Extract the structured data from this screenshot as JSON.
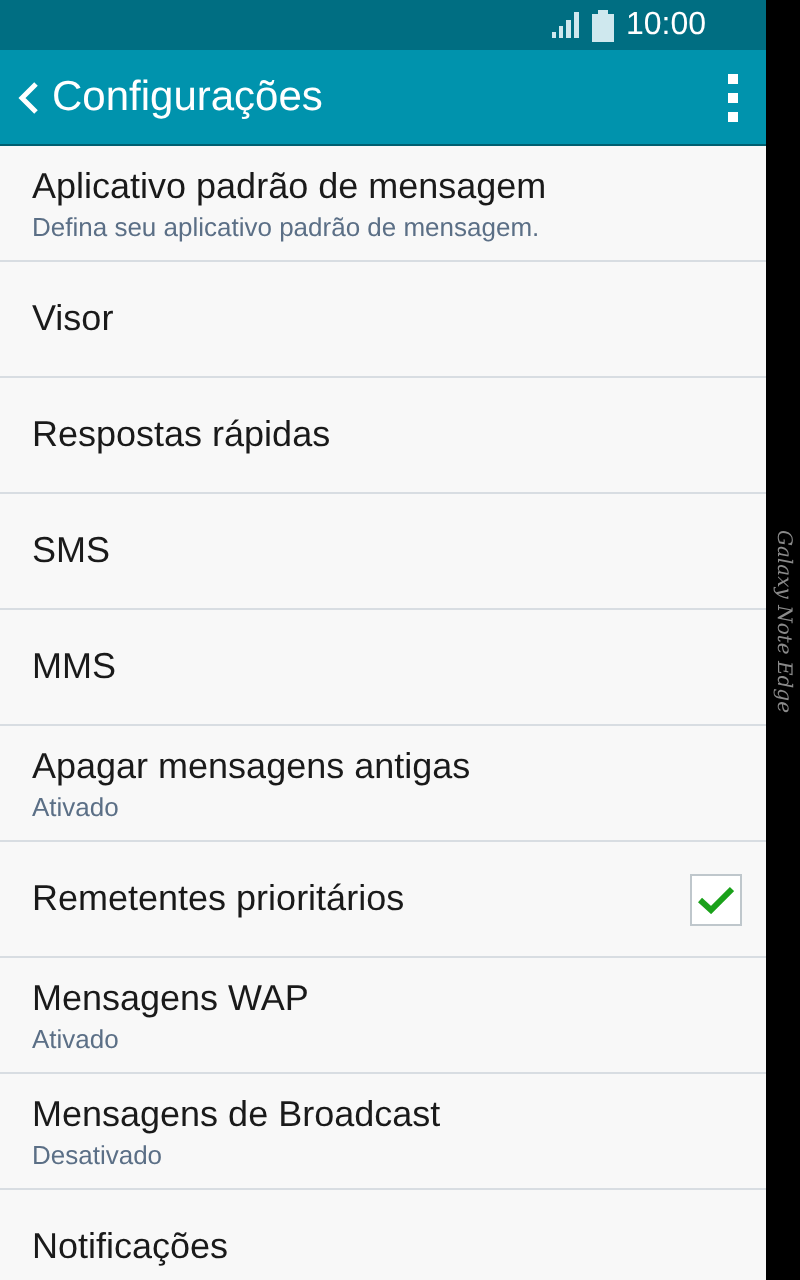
{
  "status_bar": {
    "time": "10:00"
  },
  "app_bar": {
    "title": "Configurações"
  },
  "items": [
    {
      "kind": "text",
      "title": "Aplicativo padrão de mensagem",
      "subtitle": "Defina seu aplicativo padrão de mensagem."
    },
    {
      "kind": "text",
      "title": "Visor"
    },
    {
      "kind": "text",
      "title": "Respostas rápidas"
    },
    {
      "kind": "text",
      "title": "SMS"
    },
    {
      "kind": "text",
      "title": "MMS"
    },
    {
      "kind": "text",
      "title": "Apagar mensagens antigas",
      "subtitle": "Ativado"
    },
    {
      "kind": "checkbox",
      "title": "Remetentes prioritários",
      "checked": true
    },
    {
      "kind": "text",
      "title": "Mensagens WAP",
      "subtitle": "Ativado"
    },
    {
      "kind": "text",
      "title": "Mensagens de Broadcast",
      "subtitle": "Desativado"
    },
    {
      "kind": "text",
      "title": "Notificações"
    }
  ],
  "edge_panel": {
    "text": "Galaxy Note Edge"
  }
}
